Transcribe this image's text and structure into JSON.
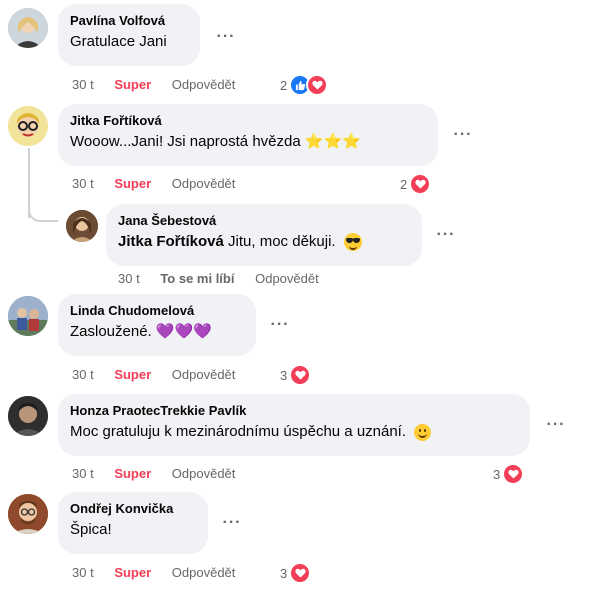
{
  "comments": [
    {
      "author": "Pavlína Volfová",
      "text": "Gratulace Jani",
      "time": "30 t",
      "reaction_label": "Super",
      "reply_label": "Odpovědět",
      "reaction_count": "2",
      "reactions": [
        "like-icon",
        "love-icon"
      ],
      "avatar_color": "#d8c7a8"
    },
    {
      "author": "Jitka Fořtíková",
      "text": "Wooow...Jani! Jsi naprostá hvězda",
      "emoji": "⭐⭐⭐",
      "time": "30 t",
      "reaction_label": "Super",
      "reply_label": "Odpovědět",
      "reaction_count": "2",
      "reactions": [
        "love-icon"
      ],
      "avatar_color": "#e9d77a"
    },
    {
      "author": "Jana Šebestová",
      "mention": "Jitka Fořtíková",
      "text": "Jitu, moc děkuji.",
      "emoji": "😎",
      "time": "30 t",
      "reaction_label": "To se mi líbí",
      "reply_label": "Odpovědět",
      "avatar_color": "#8a6a4c"
    },
    {
      "author": "Linda Chudomelová",
      "text": "Zasloužené.",
      "emoji": "💜💜💜",
      "time": "30 t",
      "reaction_label": "Super",
      "reply_label": "Odpovědět",
      "reaction_count": "3",
      "reactions": [
        "love-icon"
      ],
      "avatar_color": "#7f93b3"
    },
    {
      "author": "Honza PraotecTrekkie Pavlík",
      "text": "Moc gratuluju k mezinárodnímu úspěchu a uznání.",
      "emoji": "🙂",
      "time": "30 t",
      "reaction_label": "Super",
      "reply_label": "Odpovědět",
      "reaction_count": "3",
      "reactions": [
        "love-icon"
      ],
      "avatar_color": "#3c3c3c"
    },
    {
      "author": "Ondřej Konvička",
      "text": "Špica!",
      "time": "30 t",
      "reaction_label": "Super",
      "reply_label": "Odpovědět",
      "reaction_count": "3",
      "reactions": [
        "love-icon"
      ],
      "avatar_color": "#a0522d"
    }
  ],
  "more_label": "···",
  "colors": {
    "bubble": "#f0f2f5",
    "love": "#f33e58",
    "like": "#1877f2",
    "meta": "#65676b"
  }
}
